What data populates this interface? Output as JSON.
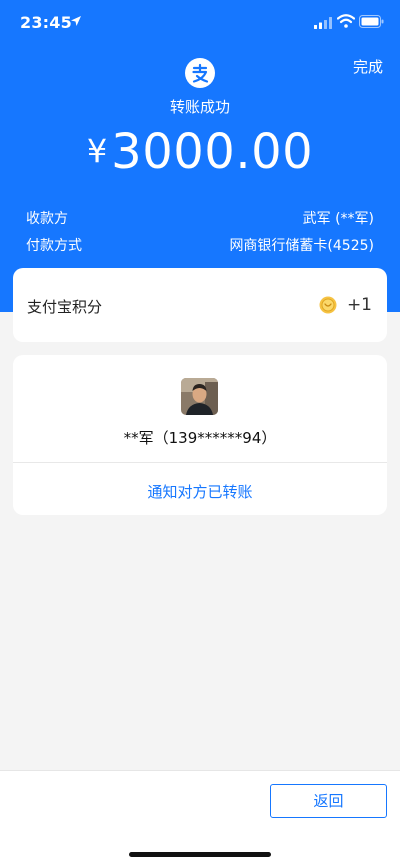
{
  "status_bar": {
    "time": "23:45",
    "icons": [
      "location-arrow-icon",
      "signal-icon",
      "wifi-icon",
      "battery-icon"
    ]
  },
  "header": {
    "done_label": "完成",
    "logo_icon": "alipay-logo-icon",
    "title": "转账成功",
    "currency_symbol": "¥",
    "amount": "3000.00"
  },
  "details": {
    "payee_label": "收款方",
    "payee_value": "武军 (**军)",
    "method_label": "付款方式",
    "method_value": "网商银行储蓄卡(4525)"
  },
  "points": {
    "label": "支付宝积分",
    "icon": "coin-icon",
    "value": "+1"
  },
  "recipient": {
    "avatar_icon": "avatar",
    "name": "**军（139******94）",
    "notify_label": "通知对方已转账"
  },
  "footer": {
    "back_label": "返回"
  },
  "colors": {
    "primary": "#1677ff",
    "background": "#f4f4f4",
    "card": "#ffffff",
    "text": "#222222"
  }
}
